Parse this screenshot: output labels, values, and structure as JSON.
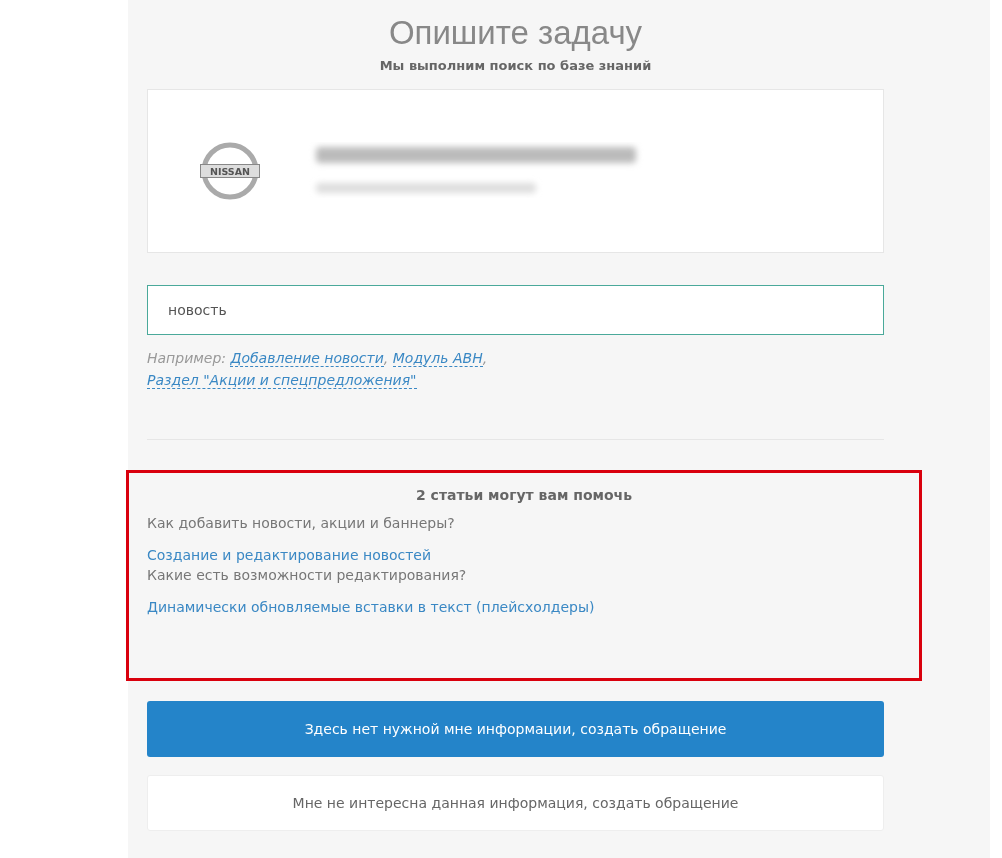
{
  "title": "Опишите задачу",
  "subtitle": "Мы выполним поиск по базе знаний",
  "card": {
    "logo_text": "NISSAN"
  },
  "search": {
    "value": "новость"
  },
  "examples": {
    "label": "Например:",
    "links": [
      {
        "text": "Добавление новости",
        "separator": ","
      },
      {
        "text": "Модуль АВН",
        "separator": ","
      },
      {
        "text": "Раздел \"Акции и спецпредложения\""
      }
    ]
  },
  "results": {
    "heading": "2 статьи могут вам помочь",
    "items": [
      {
        "kind": "question",
        "text": "Как добавить новости, акции и баннеры?"
      },
      {
        "kind": "link",
        "text": "Создание и редактирование новостей"
      },
      {
        "kind": "question",
        "text": "Какие есть возможности редактирования?"
      },
      {
        "kind": "link",
        "text": "Динамически обновляемые вставки в текст (плейсхолдеры)"
      }
    ]
  },
  "buttons": [
    {
      "kind": "primary",
      "label": "Здесь нет нужной мне информации, создать обращение"
    },
    {
      "kind": "secondary",
      "label": "Мне не интересна данная информация, создать обращение"
    }
  ]
}
